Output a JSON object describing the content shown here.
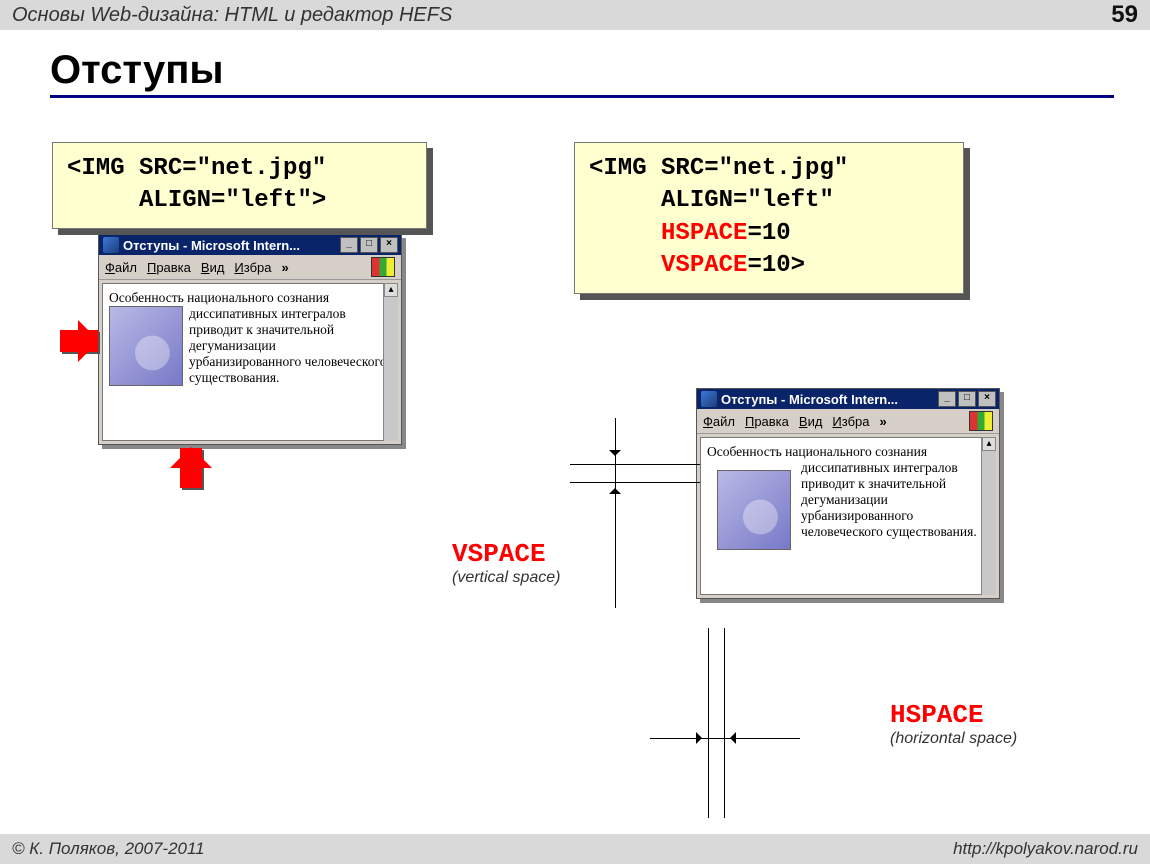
{
  "header": {
    "title": "Основы Web-дизайна: HTML и редактор HEFS",
    "page": "59"
  },
  "slide": {
    "title": "Отступы"
  },
  "code": {
    "left_l1": "<IMG SRC=\"net.jpg\"",
    "left_l2": "     ALIGN=\"left\">",
    "right_l1": "<IMG SRC=\"net.jpg\"",
    "right_l2": "     ALIGN=\"left\"",
    "right_l3a": "     ",
    "right_l3b": "HSPACE",
    "right_l3c": "=10",
    "right_l4a": "     ",
    "right_l4b": "VSPACE",
    "right_l4c": "=10>"
  },
  "browser": {
    "title": "Отступы - Microsoft Intern...",
    "menu": {
      "file": "Файл",
      "edit": "Правка",
      "view": "Вид",
      "fav": "Избра",
      "more": "»"
    },
    "text_a": "Особенность национального сознания диссипативных ",
    "text_b": "интегралов приводит к значительной дегуманизации урбанизированного человеческого существования."
  },
  "labels": {
    "vspace": "VSPACE",
    "vspace_sub": "(vertical space)",
    "hspace": "HSPACE",
    "hspace_sub": "(horizontal space)"
  },
  "footer": {
    "left": "© К. Поляков, 2007-2011",
    "right": "http://kpolyakov.narod.ru"
  }
}
